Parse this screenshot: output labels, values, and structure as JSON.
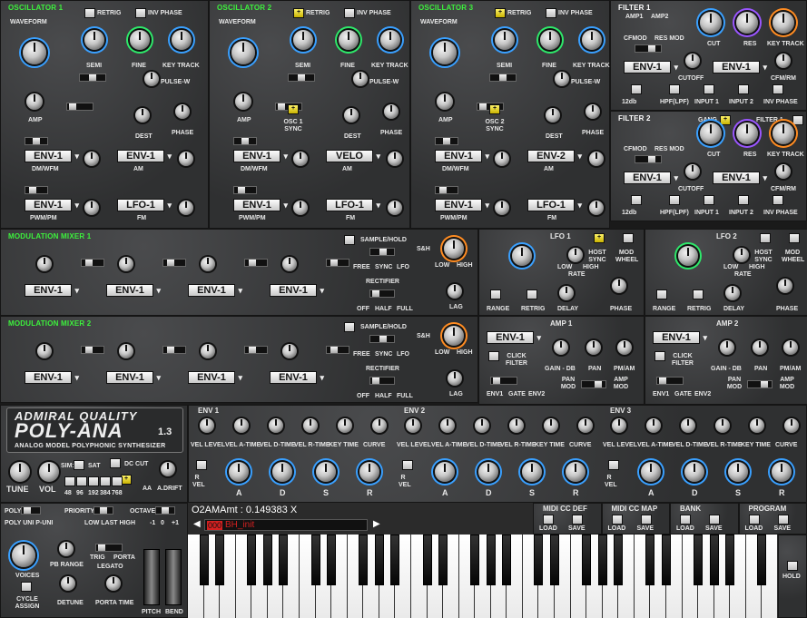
{
  "oscillators": [
    {
      "title": "OSCILLATOR 1",
      "retrig": "RETRIG",
      "inv_phase": "INV PHASE",
      "waveform": "WAVEFORM",
      "semi": "SEMI",
      "fine": "FINE",
      "key_track": "KEY TRACK",
      "pulse_w": "PULSE-W",
      "amp": "AMP",
      "dest": "DEST",
      "phase": "PHASE",
      "dm_wfm": "DM/WFM",
      "am": "AM",
      "pwm_pm": "PWM/PM",
      "fm": "FM",
      "mod1": "ENV-1",
      "mod2": "ENV-1",
      "mod3": "ENV-1",
      "mod4": "LFO-1"
    },
    {
      "title": "OSCILLATOR 2",
      "retrig": "RETRIG",
      "inv_phase": "INV PHASE",
      "waveform": "WAVEFORM",
      "semi": "SEMI",
      "fine": "FINE",
      "key_track": "KEY TRACK",
      "pulse_w": "PULSE-W",
      "amp": "AMP",
      "dest": "DEST",
      "phase": "PHASE",
      "sync": "OSC 1 SYNC",
      "dm_wfm": "DM/WFM",
      "am": "AM",
      "pwm_pm": "PWM/PM",
      "fm": "FM",
      "mod1": "ENV-1",
      "mod2": "VELO",
      "mod3": "ENV-1",
      "mod4": "LFO-1"
    },
    {
      "title": "OSCILLATOR 3",
      "retrig": "RETRIG",
      "inv_phase": "INV PHASE",
      "waveform": "WAVEFORM",
      "semi": "SEMI",
      "fine": "FINE",
      "key_track": "KEY TRACK",
      "pulse_w": "PULSE-W",
      "amp": "AMP",
      "dest": "DEST",
      "phase": "PHASE",
      "sync": "OSC 2 SYNC",
      "dm_wfm": "DM/WFM",
      "am": "AM",
      "pwm_pm": "PWM/PM",
      "fm": "FM",
      "mod1": "ENV-1",
      "mod2": "ENV-2",
      "mod3": "ENV-1",
      "mod4": "LFO-1"
    }
  ],
  "filters": [
    {
      "title": "FILTER 1",
      "amp1": "AMP1",
      "amp2": "AMP2",
      "cfmod": "CFMOD",
      "res_mod": "RES MOD",
      "cut": "CUT",
      "res": "RES",
      "key_track": "KEY TRACK",
      "cutoff": "CUTOFF",
      "cfm_rm": "CFM/RM",
      "mod1": "ENV-1",
      "mod2": "ENV-1",
      "opts": [
        "12db",
        "HPF(LPF)",
        "INPUT 1",
        "INPUT 2",
        "INV PHASE"
      ]
    },
    {
      "title": "FILTER 2",
      "gang": "GANG",
      "filter1": "FILTER 1",
      "cfmod": "CFMOD",
      "res_mod": "RES MOD",
      "cut": "CUT",
      "res": "RES",
      "key_track": "KEY TRACK",
      "cutoff": "CUTOFF",
      "cfm_rm": "CFM/RM",
      "mod1": "ENV-1",
      "mod2": "ENV-1",
      "opts": [
        "12db",
        "HPF(LPF)",
        "INPUT 1",
        "INPUT 2",
        "INV PHASE"
      ]
    }
  ],
  "mixers": [
    {
      "title": "MODULATION MIXER 1",
      "sources": [
        "ENV-1",
        "ENV-1",
        "ENV-1",
        "ENV-1"
      ],
      "sh": "SAMPLE/HOLD",
      "sh_short": "S&H",
      "free": "FREE",
      "sync": "SYNC",
      "lfo": "LFO",
      "rect": "RECTIFIER",
      "off": "OFF",
      "half": "HALF",
      "full": "FULL",
      "low": "LOW",
      "high": "HIGH",
      "lag": "LAG"
    },
    {
      "title": "MODULATION MIXER 2",
      "sources": [
        "ENV-1",
        "ENV-1",
        "ENV-1",
        "ENV-1"
      ],
      "sh": "SAMPLE/HOLD",
      "sh_short": "S&H",
      "free": "FREE",
      "sync": "SYNC",
      "lfo": "LFO",
      "rect": "RECTIFIER",
      "off": "OFF",
      "half": "HALF",
      "full": "FULL",
      "low": "LOW",
      "high": "HIGH",
      "lag": "LAG"
    }
  ],
  "lfos": [
    {
      "title": "LFO 1",
      "host_sync": "HOST SYNC",
      "mod_wheel": "MOD WHEEL",
      "low": "LOW",
      "high": "HIGH",
      "rate": "RATE",
      "range": "RANGE",
      "retrig": "RETRIG",
      "delay": "DELAY",
      "phase": "PHASE"
    },
    {
      "title": "LFO 2",
      "host_sync": "HOST SYNC",
      "mod_wheel": "MOD WHEEL",
      "low": "LOW",
      "high": "HIGH",
      "rate": "RATE",
      "range": "RANGE",
      "retrig": "RETRIG",
      "delay": "DELAY",
      "phase": "PHASE"
    }
  ],
  "amps": [
    {
      "title": "AMP 1",
      "source": "ENV-1",
      "click": "CLICK FILTER",
      "gain_db": "GAIN - DB",
      "pan": "PAN",
      "pm_am": "PM/AM",
      "pan_mod": "PAN MOD",
      "amp_mod": "AMP MOD",
      "env1": "ENV1",
      "gate": "GATE",
      "env2": "ENV2"
    },
    {
      "title": "AMP 2",
      "source": "ENV-1",
      "click": "CLICK FILTER",
      "gain_db": "GAIN - DB",
      "pan": "PAN",
      "pm_am": "PM/AM",
      "pan_mod": "PAN MOD",
      "amp_mod": "AMP MOD",
      "env1": "ENV1",
      "gate": "GATE",
      "env2": "ENV2"
    }
  ],
  "envelopes": [
    {
      "title": "ENV 1",
      "labels": [
        "VEL LEVEL",
        "VEL A-TIME",
        "VEL D-TIME",
        "VEL R-TIME",
        "KEY TIME",
        "CURVE"
      ],
      "adsr": [
        "A",
        "D",
        "S",
        "R"
      ],
      "vel": "R VEL"
    },
    {
      "title": "ENV 2",
      "labels": [
        "VEL LEVEL",
        "VEL A-TIME",
        "VEL D-TIME",
        "VEL R-TIME",
        "KEY TIME",
        "CURVE"
      ],
      "adsr": [
        "A",
        "D",
        "S",
        "R"
      ],
      "vel": "R VEL"
    },
    {
      "title": "ENV 3",
      "labels": [
        "VEL LEVEL",
        "VEL A-TIME",
        "VEL D-TIME",
        "VEL R-TIME",
        "KEY TIME",
        "CURVE"
      ],
      "adsr": [
        "A",
        "D",
        "S",
        "R"
      ],
      "vel": "R VEL"
    }
  ],
  "logo": {
    "brand": "ADMIRAL QUALITY",
    "product": "POLY-ANA",
    "version": "1.3",
    "tagline": "ANALOG MODEL POLYPHONIC SYNTHESIZER"
  },
  "global": {
    "tune": "TUNE",
    "vol": "VOL",
    "sim": "SIM:",
    "sat": "SAT",
    "dc_cut": "DC CUT",
    "aa": "AA",
    "adrift": "A.DRIFT",
    "oversample": [
      "48",
      "96",
      "192",
      "384",
      "768"
    ],
    "poly": "POLY",
    "uni": "UNI",
    "p_uni": "P-UNI",
    "priority": "PRIORITY",
    "low_last_high": "LOW LAST HIGH",
    "octave": "OCTAVE",
    "oct_vals": [
      "-1",
      "0",
      "+1"
    ],
    "voices": "VOICES",
    "pb_range": "PB RANGE",
    "trig": "TRIG",
    "porta": "PORTA",
    "legato": "LEGATO",
    "cycle_assign": "CYCLE ASSIGN",
    "detune": "DETUNE",
    "porta_time": "PORTA TIME",
    "pitch": "PITCH",
    "bend": "BEND",
    "hold": "HOLD"
  },
  "status": {
    "param": "O2AMAmt : 0.149383 X",
    "preset_num": "000",
    "preset_name": "BH_init"
  },
  "menus": [
    {
      "title": "MIDI CC DEF",
      "load": "LOAD",
      "save": "SAVE"
    },
    {
      "title": "MIDI CC MAP",
      "load": "LOAD",
      "save": "SAVE"
    },
    {
      "title": "BANK",
      "load": "LOAD",
      "save": "SAVE"
    },
    {
      "title": "PROGRAM",
      "load": "LOAD",
      "save": "SAVE"
    }
  ],
  "colors": {
    "title_green": "#3df03d",
    "led_yellow": "#e6e300",
    "preset_red": "#d42020"
  }
}
